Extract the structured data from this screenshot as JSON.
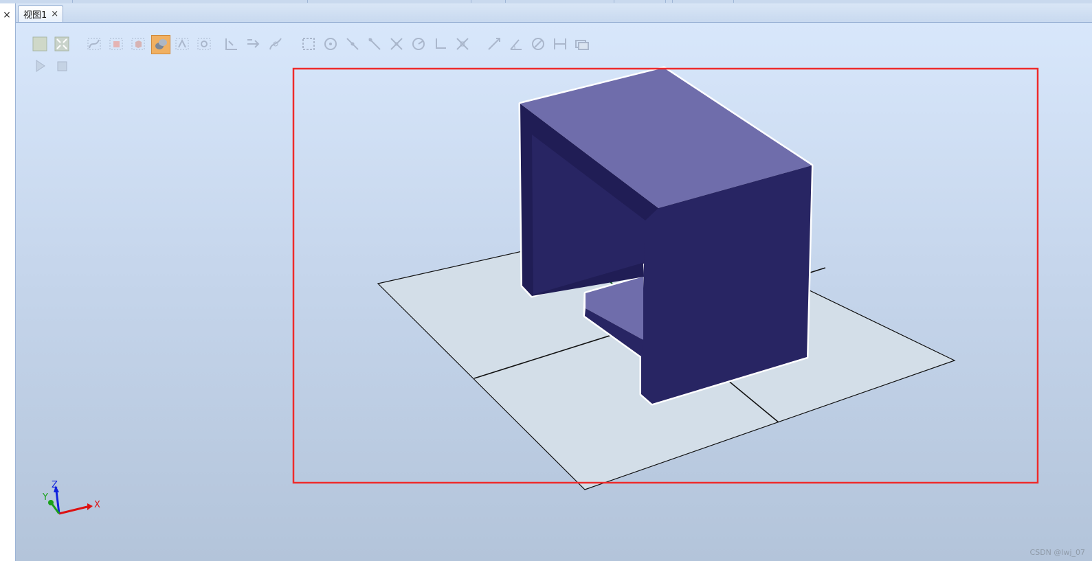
{
  "left_panel": {
    "close_glyph": "×"
  },
  "tabs": [
    {
      "label": "视图1",
      "close_glyph": "×",
      "active": true
    }
  ],
  "toolbar": {
    "icons": [
      "view-solid-icon",
      "view-all-icon",
      "select-curve-icon",
      "select-surface-icon",
      "select-body-icon",
      "select-part-icon",
      "select-group-icon",
      "select-mechanism-icon",
      "snap-local-origin-icon",
      "snap-move-icon",
      "snap-path-icon",
      "snap-object-icon",
      "snap-center-icon",
      "snap-midpoint-icon",
      "snap-edge-icon",
      "snap-intersection-icon",
      "snap-pivot-icon",
      "snap-frame-icon",
      "snap-grid-icon",
      "measure-distance-icon",
      "measure-angle-icon",
      "measure-diameter-icon",
      "measure-shortest-icon",
      "keep-measurement-icon",
      "play-icon",
      "stop-icon"
    ],
    "active_icon": "select-part-icon"
  },
  "axes": {
    "x_label": "X",
    "y_label": "Y",
    "z_label": "Z",
    "x_color": "#dd1111",
    "y_color": "#1aa11a",
    "z_color": "#1122dd"
  },
  "colors": {
    "part_top": "#6f6dab",
    "part_front": "#282563",
    "part_dark": "#201d55",
    "floor": "#d3dee8",
    "highlight_box": "#ee2b2b"
  },
  "watermark": "CSDN @lwj_07"
}
